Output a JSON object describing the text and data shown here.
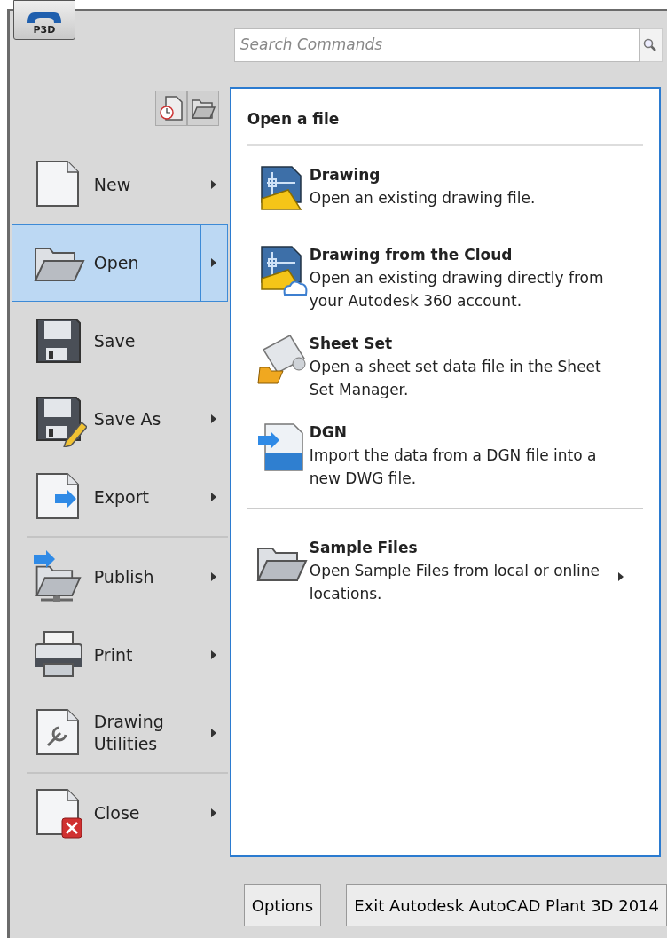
{
  "app_button": {
    "label": "P3D"
  },
  "search": {
    "placeholder": "Search Commands"
  },
  "menu": {
    "groups": [
      [
        {
          "label": "New",
          "has_submenu": true,
          "selected": false
        },
        {
          "label": "Open",
          "has_submenu": true,
          "selected": true
        },
        {
          "label": "Save",
          "has_submenu": false,
          "selected": false
        },
        {
          "label": "Save As",
          "has_submenu": true,
          "selected": false
        },
        {
          "label": "Export",
          "has_submenu": true,
          "selected": false
        }
      ],
      [
        {
          "label": "Publish",
          "has_submenu": true,
          "selected": false
        },
        {
          "label": "Print",
          "has_submenu": true,
          "selected": false
        },
        {
          "label": "Drawing Utilities",
          "has_submenu": true,
          "selected": false
        }
      ],
      [
        {
          "label": "Close",
          "has_submenu": true,
          "selected": false
        }
      ]
    ]
  },
  "panel": {
    "title": "Open a file",
    "groups": [
      [
        {
          "title": "Drawing",
          "description": "Open an existing drawing file.",
          "has_submenu": false
        },
        {
          "title": "Drawing from the Cloud",
          "description": "Open an existing drawing directly from your Autodesk 360 account.",
          "has_submenu": false
        },
        {
          "title": "Sheet Set",
          "description": "Open a sheet set data file in the Sheet Set Manager.",
          "has_submenu": false
        },
        {
          "title": "DGN",
          "description": "Import the data from a DGN file into a new DWG file.",
          "has_submenu": false
        }
      ],
      [
        {
          "title": "Sample Files",
          "description": "Open Sample Files from local or online locations.",
          "has_submenu": true
        }
      ]
    ]
  },
  "footer_buttons": [
    {
      "label": "Options"
    },
    {
      "label": "Exit Autodesk AutoCAD Plant 3D 2014"
    }
  ]
}
